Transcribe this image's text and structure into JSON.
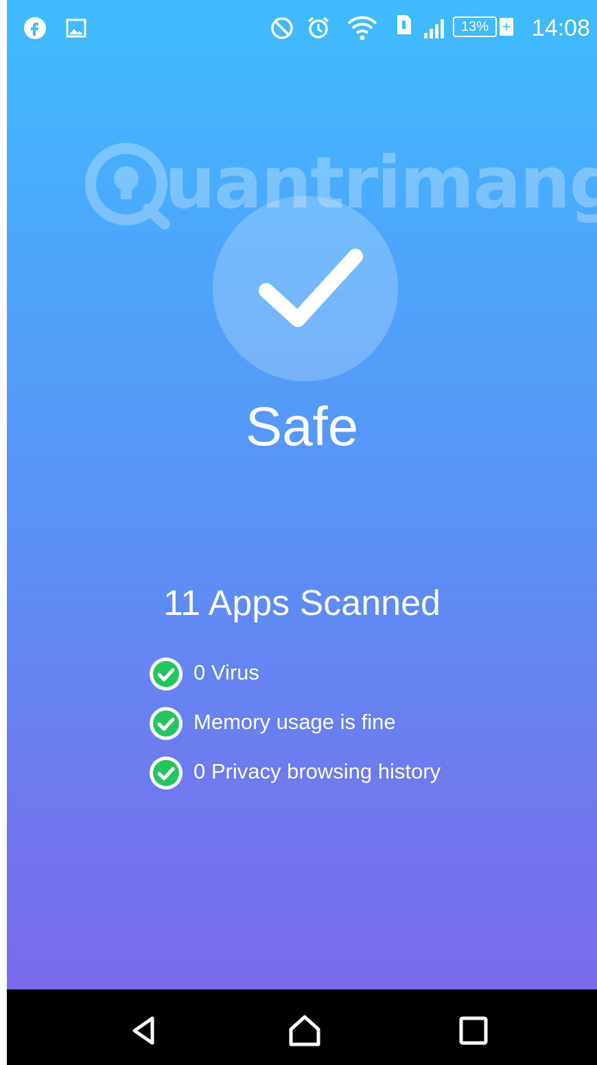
{
  "status_bar": {
    "time": "14:08",
    "battery_percent": "13%",
    "left_icons": [
      "facebook-icon",
      "image-icon"
    ],
    "right_icons": [
      "do-not-disturb-icon",
      "alarm-icon",
      "wifi-icon",
      "sim-icon",
      "signal-icon",
      "battery-charging-icon"
    ]
  },
  "watermark": {
    "text": "uantrimang"
  },
  "scan_result": {
    "status": "Safe",
    "apps_scanned": "11 Apps Scanned",
    "items": [
      {
        "label": "0 Virus",
        "icon": "check-circle-icon"
      },
      {
        "label": "Memory usage is fine",
        "icon": "check-circle-icon"
      },
      {
        "label": "0 Privacy browsing history",
        "icon": "check-circle-icon"
      }
    ]
  },
  "nav_bar": {
    "buttons": [
      "back-icon",
      "home-icon",
      "recents-icon"
    ]
  },
  "colors": {
    "gradient_top": "#3fbcfd",
    "gradient_bottom": "#7a6bec",
    "check_green": "#22c55e",
    "nav_background": "#000000"
  }
}
